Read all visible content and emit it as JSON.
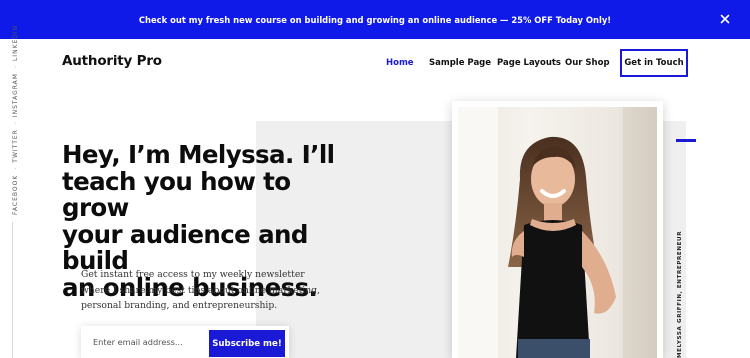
{
  "announcement": {
    "text": "Check out my fresh new course on building and growing an online audience — 25% OFF Today Only!",
    "close_icon": "close-icon",
    "background": "#0f19e8"
  },
  "social": {
    "links": [
      "FACEBOOK",
      "TWITTER",
      "INSTAGRAM",
      "LINKEDIN"
    ],
    "separator": "·"
  },
  "header": {
    "brand": "Authority Pro",
    "nav": [
      {
        "label": "Home",
        "active": true
      },
      {
        "label": "Sample Page",
        "active": false
      },
      {
        "label": "Page Layouts",
        "active": false
      },
      {
        "label": "Our Shop",
        "active": false
      }
    ],
    "cta_label": "Get in Touch",
    "accent": "#1a1ad6"
  },
  "hero": {
    "headline_lines": [
      "Hey, I’m Melyssa. I’ll",
      "teach you how to grow",
      "your audience and build",
      "an online business."
    ],
    "intro": "Get instant free access to my weekly newsletter where I share my best tips about online marketing, personal branding, and entrepreneurship.",
    "email_placeholder": "Enter email address...",
    "subscribe_label": "Subscribe me!",
    "photo_caption": "MELYSSA GRIFFIN, ENTREPRENEUR"
  }
}
